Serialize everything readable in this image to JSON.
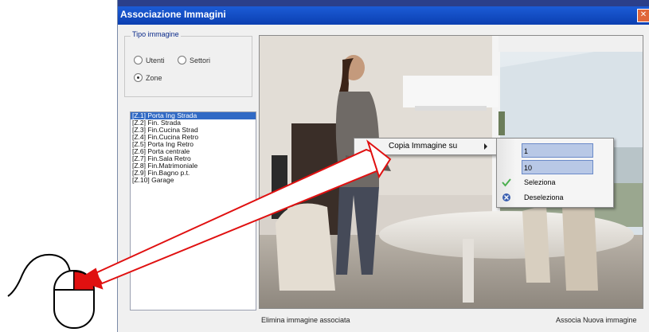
{
  "window": {
    "title": "Associazione Immagini",
    "close_glyph": "✕"
  },
  "tipo_immagine": {
    "label": "Tipo immagine",
    "options": [
      {
        "label": "Utenti",
        "checked": false
      },
      {
        "label": "Settori",
        "checked": false
      },
      {
        "label": "Zone",
        "checked": true
      }
    ]
  },
  "zone_list": {
    "items": [
      "[Z.1] Porta Ing Strada",
      "[Z.2] Fin. Strada",
      "[Z.3] Fin.Cucina Strad",
      "[Z.4] Fin.Cucina Retro",
      "[Z.5] Porta Ing Retro",
      "[Z.6] Porta centrale",
      "[Z.7] Fin.Sala Retro",
      "[Z.8] Fin.Matrimoniale",
      "[Z.9] Fin.Bagno p.t.",
      "[Z.10] Garage"
    ],
    "selected_index": 0
  },
  "buttons": {
    "delete_label": "Elimina immagine associata",
    "associate_label": "Associa Nuova immagine"
  },
  "context_menu": {
    "copy_label": "Copia Immagine su",
    "field_from": "1",
    "field_to": "10",
    "select_label": "Seleziona",
    "deselect_label": "Deseleziona"
  },
  "colors": {
    "selection": "#316ac5",
    "titlebar": "#0b3fb1",
    "arrow": "#e01010"
  },
  "icons": {
    "submenu_arrow": "chevron-right-icon",
    "select": "check-icon",
    "deselect": "deselect-icon",
    "mouse": "mouse-icon",
    "pointer": "red-arrow-icon"
  }
}
